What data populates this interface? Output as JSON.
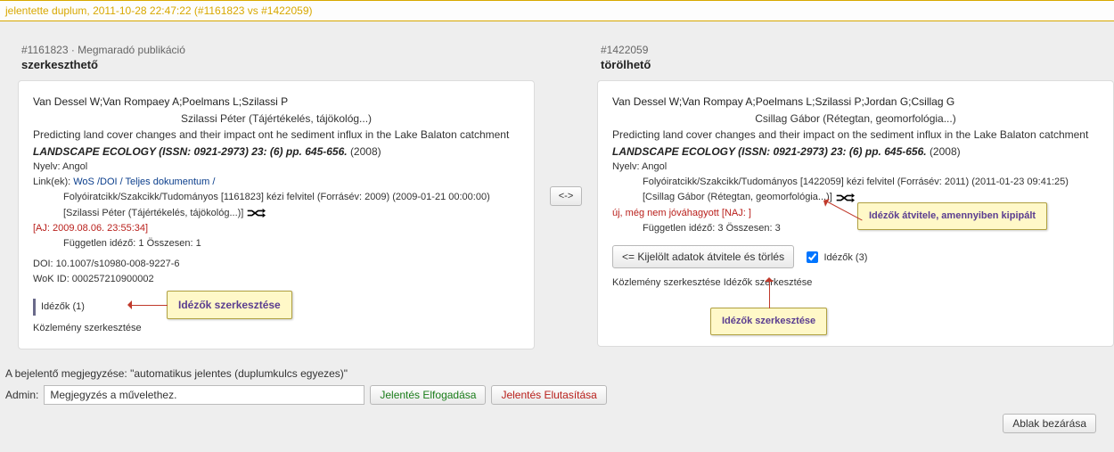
{
  "banner": "jelentette duplum, 2011-10-28 22:47:22 (#1161823 vs #1422059)",
  "left": {
    "header_id": "#1161823 · Megmaradó publikáció",
    "header_status": "szerkeszthető",
    "authors": "Van Dessel W;Van Rompaey A;Poelmans L;Szilassi P",
    "editor": "Szilassi Péter (Tájértékelés, tájökológ...)",
    "title": "Predicting land cover changes and their impact ont he sediment influx in the Lake Balaton catchment",
    "journal": "LANDSCAPE ECOLOGY (ISSN: 0921-2973)",
    "vol_issue": "23: (6)",
    "pp": "pp. 645-656.",
    "year": "(2008)",
    "nyelv": "Nyelv: Angol",
    "links_label": "Link(ek):",
    "links_items": "WoS /DOI / Teljes dokumentum /",
    "classif": "Folyóiratcikk/Szakcikk/Tudományos [1161823] kézi felvitel (Forrásév: 2009) (2009-01-21 00:00:00)",
    "bracket": "[Szilassi Péter (Tájértékelés, tájökológ...)]",
    "aj": "[AJ: 2009.08.06. 23:55:34]",
    "cites": "Független idéző: 1 Összesen: 1",
    "doi": "DOI: 10.1007/s10980-008-9227-6",
    "wok": "WoK ID: 000257210900002",
    "idezok": "Idézők (1)",
    "kozlemeny_edit": "Közlemény szerkesztése",
    "callout": "Idézők szerkesztése"
  },
  "swap": "<->",
  "right": {
    "header_id": "#1422059",
    "header_status": "törölhető",
    "authors": "Van Dessel W;Van Rompay A;Poelmans L;Szilassi P;Jordan G;Csillag G",
    "editor": "Csillag Gábor (Rétegtan, geomorfológia...)",
    "title": "Predicting land cover changes and their impact on the sediment influx in the Lake Balaton catchment",
    "journal": "LANDSCAPE ECOLOGY (ISSN: 0921-2973)",
    "vol_issue": "23: (6)",
    "pp": "pp. 645-656.",
    "year": "(2008)",
    "nyelv": "Nyelv: Angol",
    "classif": "Folyóiratcikk/Szakcikk/Tudományos [1422059] kézi felvitel (Forrásév: 2011) (2011-01-23 09:41:25)",
    "bracket": "[Csillag Gábor (Rétegtan, geomorfológia...)]",
    "warn": "új, még nem jóváhagyott [NAJ: ]",
    "cites": "Független idéző: 3 Összesen: 3",
    "transfer_btn": "<= Kijelölt adatok átvitele és törlés",
    "idezok_cb": "Idézők (3)",
    "edit_links": "Közlemény szerkesztése Idézők szerkesztése",
    "callout_top": "Idézők átvitele, amennyiben kipipált",
    "callout_bottom": "Idézők szerkesztése"
  },
  "footer": {
    "reporter": "A bejelentő megjegyzése: \"automatikus jelentes (duplumkulcs egyezes)\"",
    "admin_label": "Admin:",
    "admin_placeholder": "Megjegyzés a művelethez.",
    "accept": "Jelentés Elfogadása",
    "reject": "Jelentés Elutasítása",
    "close": "Ablak bezárása"
  }
}
